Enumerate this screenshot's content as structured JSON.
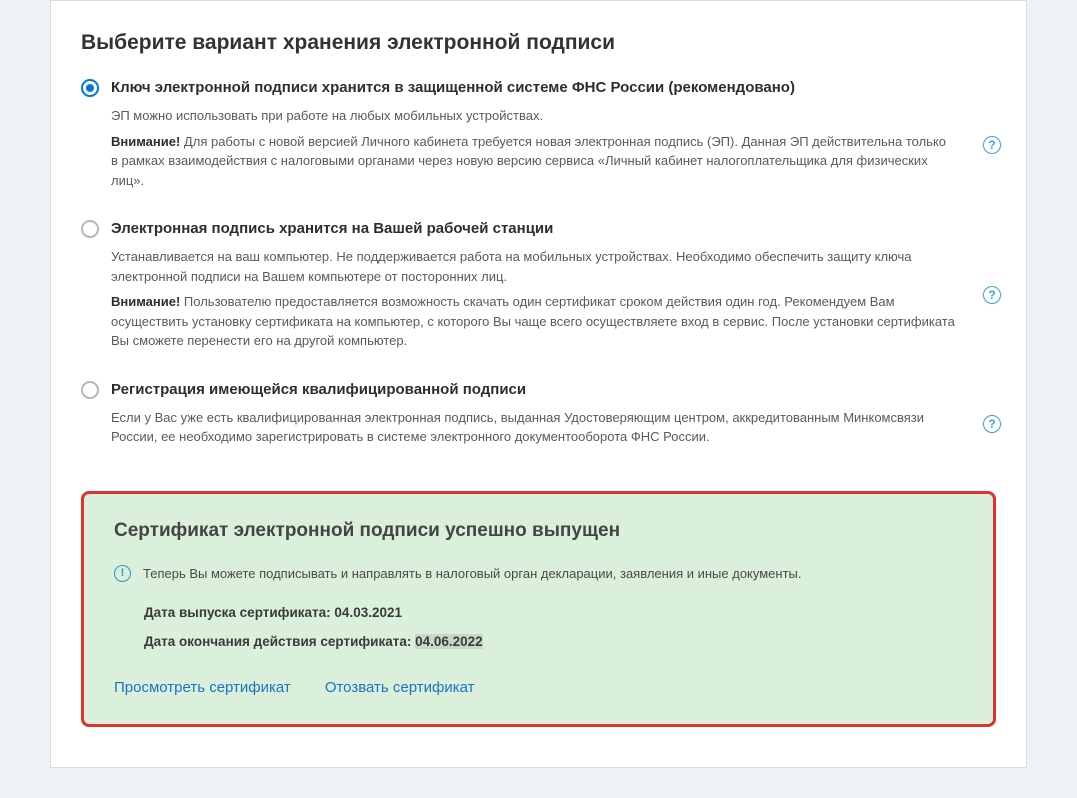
{
  "title": "Выберите вариант хранения электронной подписи",
  "options": [
    {
      "selected": true,
      "title": "Ключ электронной подписи хранится в защищенной системе ФНС России (рекомендовано)",
      "desc1": "ЭП можно использовать при работе на любых мобильных устройствах.",
      "warn_label": "Внимание!",
      "warn_text": " Для работы с новой версией Личного кабинета требуется новая электронная подпись (ЭП). Данная ЭП  действительна только в рамках взаимодействия с налоговыми органами через новую версию сервиса  «Личный кабинет налогоплательщика для физических лиц».",
      "help": "?"
    },
    {
      "selected": false,
      "title": "Электронная подпись хранится на Вашей рабочей станции",
      "desc1": "Устанавливается на ваш компьютер. Не поддерживается работа на мобильных устройствах. Необходимо обеспечить  защиту ключа электронной подписи на Вашем компьютере от посторонних лиц.",
      "warn_label": "Внимание!",
      "warn_text": " Пользователю предоставляется возможность скачать один сертификат  сроком действия один год. Рекомендуем Вам осуществить установку сертификата на компьютер, с которого Вы  чаще всего осуществляете вход в сервис. После установки сертификата Вы сможете перенести его на другой  компьютер.",
      "help": "?"
    },
    {
      "selected": false,
      "title": "Регистрация имеющейся квалифицированной подписи",
      "desc1": "Если у Вас уже есть квалифицированная электронная подпись, выданная Удостоверяющим центром, аккредитованным Минкомсвязи России, ее необходимо зарегистрировать в системе электронного документооборота ФНС России.",
      "warn_label": "",
      "warn_text": "",
      "help": "?"
    }
  ],
  "cert": {
    "title": "Сертификат электронной подписи успешно выпущен",
    "info_glyph": "!",
    "info_text": "Теперь Вы можете подписывать и направлять в налоговый орган декларации, заявления и иные документы.",
    "issued_label": "Дата выпуска сертификата: ",
    "issued_value": "04.03.2021",
    "expires_label": "Дата окончания действия сертификата: ",
    "expires_value": "04.06.2022",
    "view_link": "Просмотреть сертификат",
    "revoke_link": "Отозвать сертификат"
  }
}
